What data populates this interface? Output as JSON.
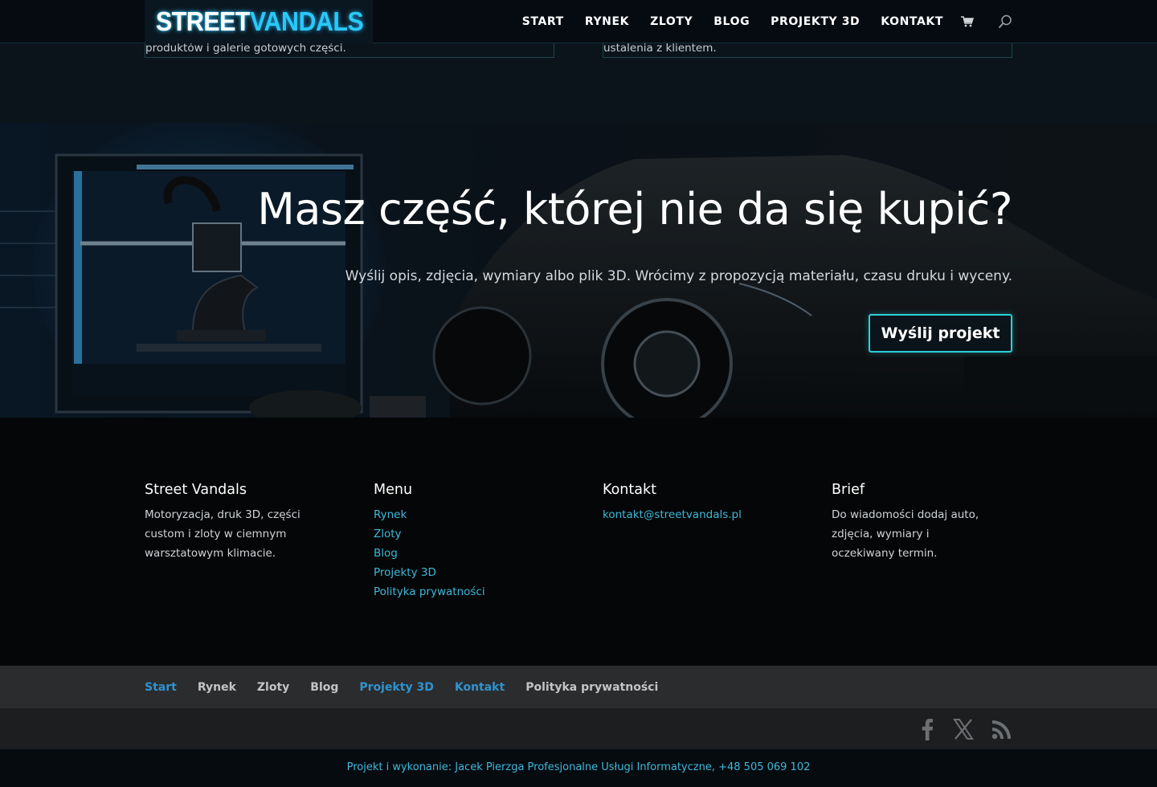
{
  "header": {
    "logo_part1": "STREET",
    "logo_part2": "VANDALS",
    "nav": [
      "START",
      "RYNEK",
      "ZLOTY",
      "BLOG",
      "PROJEKTY 3D",
      "KONTAKT"
    ],
    "cart_icon": "cart-icon",
    "search_icon": "search-icon"
  },
  "cards": [
    {
      "text": "produktów i galerie gotowych części."
    },
    {
      "text": "ustalenia z klientem."
    }
  ],
  "hero": {
    "title": "Masz część, której nie da się kupić?",
    "subtitle": "Wyślij opis, zdjęcia, wymiary albo plik 3D. Wrócimy z propozycją materiału, czasu druku i wyceny.",
    "button": "Wyślij projekt"
  },
  "footer": {
    "col1": {
      "heading": "Street Vandals",
      "text": "Motoryzacja, druk 3D, części custom i zloty w ciemnym warsztatowym klimacie."
    },
    "col2": {
      "heading": "Menu",
      "links": [
        "Rynek",
        "Zloty",
        "Blog",
        "Projekty 3D",
        "Polityka prywatności"
      ]
    },
    "col3": {
      "heading": "Kontakt",
      "email": "kontakt@streetvandals.pl"
    },
    "col4": {
      "heading": "Brief",
      "text": "Do wiadomości dodaj auto, zdjęcia, wymiary i oczekiwany termin."
    }
  },
  "bottom_nav": [
    "Start",
    "Rynek",
    "Zloty",
    "Blog",
    "Projekty 3D",
    "Kontakt",
    "Polityka prywatności"
  ],
  "social_icons": [
    "facebook-icon",
    "x-icon",
    "rss-icon"
  ],
  "credits": "Projekt i wykonanie: Jacek Pierzga Profesjonalne Usługi Informatyczne, +48 505 069 102",
  "colors": {
    "accent": "#3fb8d9",
    "active_link": "#2f93d1",
    "button_border": "#2ed0d6"
  }
}
